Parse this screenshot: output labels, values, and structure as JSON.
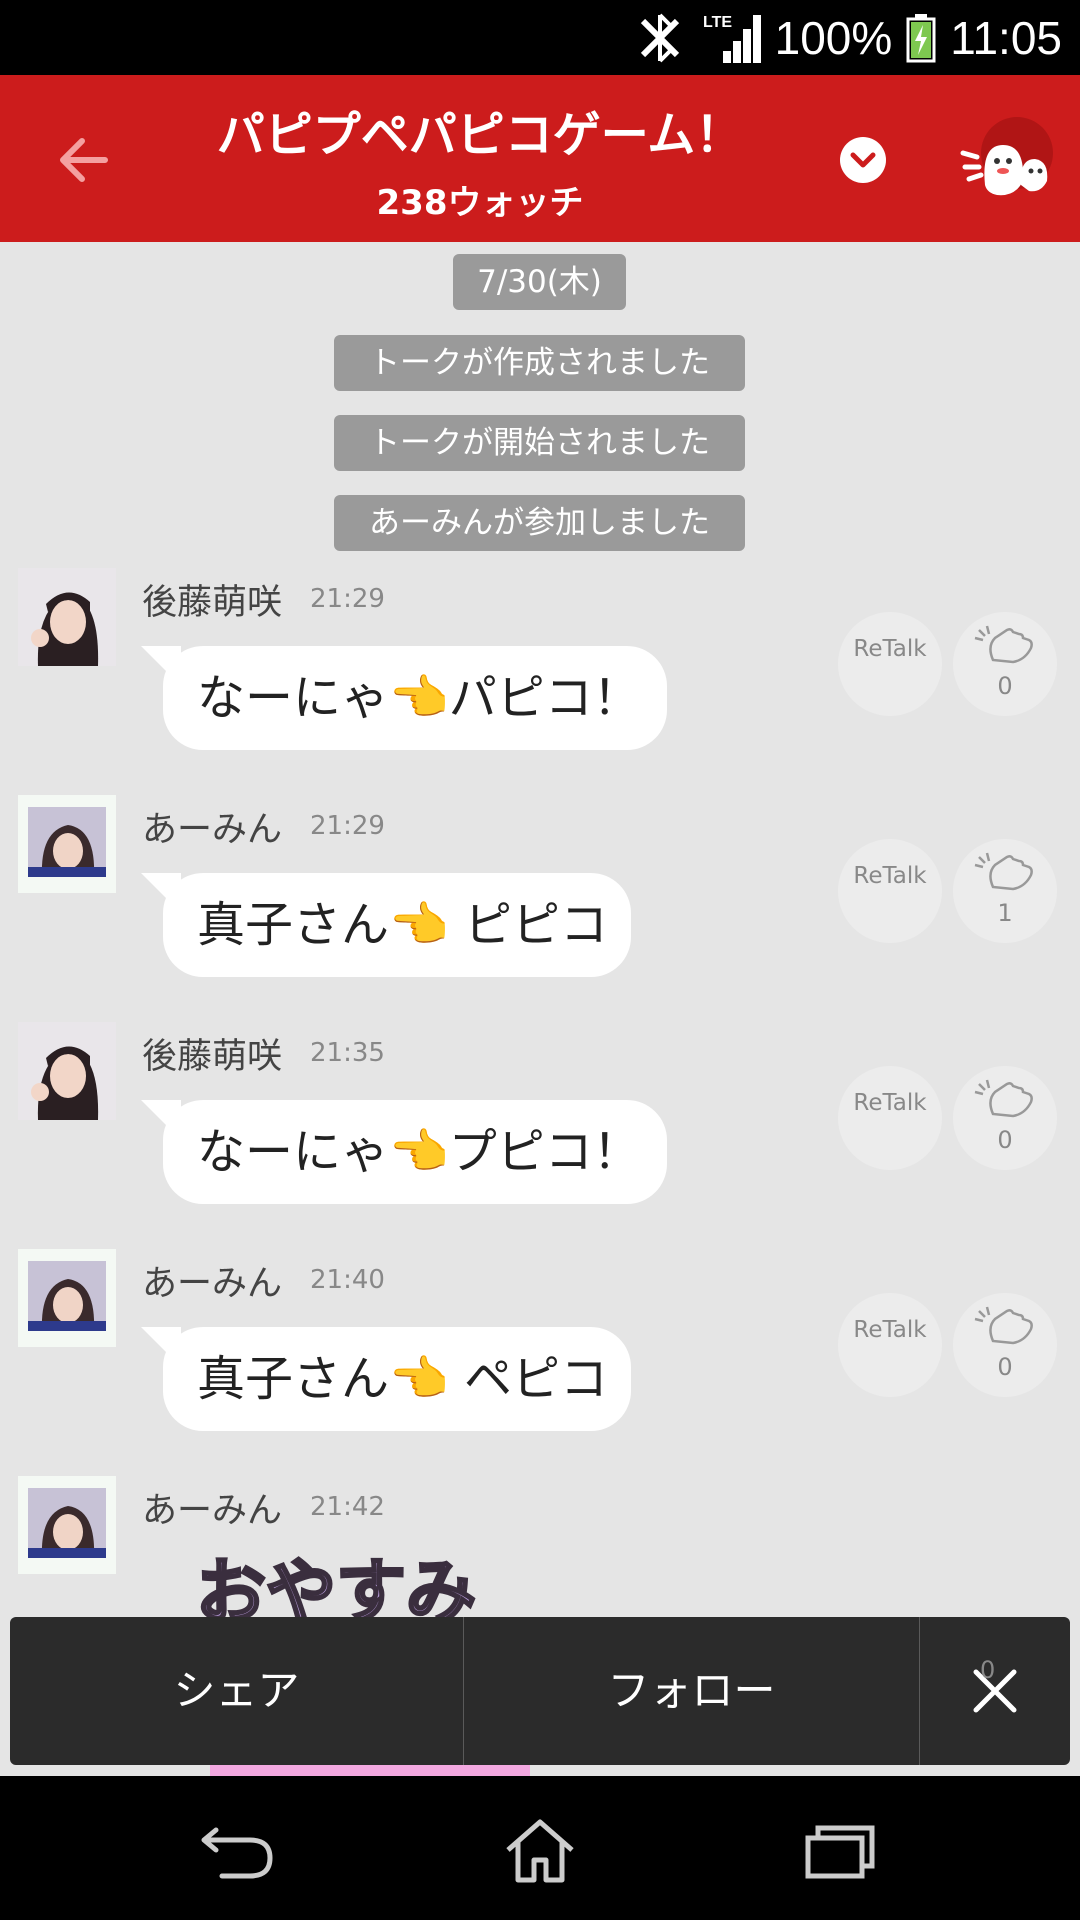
{
  "status_bar": {
    "battery": "100%",
    "time": "11:05",
    "icons": [
      "bluetooth-icon",
      "lte-signal-icon",
      "battery-charging-icon"
    ]
  },
  "header": {
    "title": "パピプペパピコゲーム！",
    "subtitle": "238ウォッチ",
    "icons": [
      "back-arrow-icon",
      "chevron-down-icon",
      "mascot-icon"
    ]
  },
  "system_messages": [
    "7/30(木)",
    "トークが作成されました",
    "トークが開始されました",
    "あーみんが参加しました"
  ],
  "messages": [
    {
      "sender": "後藤萌咲",
      "time": "21:29",
      "text": "なーにゃ👈パピコ！",
      "retalk": "ReTalk",
      "claps": "0"
    },
    {
      "sender": "あーみん",
      "time": "21:29",
      "text": "真子さん👈 ピピコ",
      "retalk": "ReTalk",
      "claps": "1"
    },
    {
      "sender": "後藤萌咲",
      "time": "21:35",
      "text": "なーにゃ👈プピコ！",
      "retalk": "ReTalk",
      "claps": "0"
    },
    {
      "sender": "あーみん",
      "time": "21:40",
      "text": "真子さん👈 ペピコ",
      "retalk": "ReTalk",
      "claps": "0"
    },
    {
      "sender": "あーみん",
      "time": "21:42",
      "sticker_text": "おやすみ"
    }
  ],
  "hidden_clap_count": "0",
  "bottom_bar": {
    "share_label": "シェア",
    "follow_label": "フォロー",
    "close_icon": "close-icon"
  },
  "nav_bar": {
    "icons": [
      "back-icon",
      "home-icon",
      "recent-apps-icon"
    ]
  },
  "colors": {
    "header_red": "#cc1c1c",
    "chat_bg": "#e5e5e5",
    "system_pill": "#9a9a9a",
    "bottom_bar": "#2b2b2b"
  }
}
